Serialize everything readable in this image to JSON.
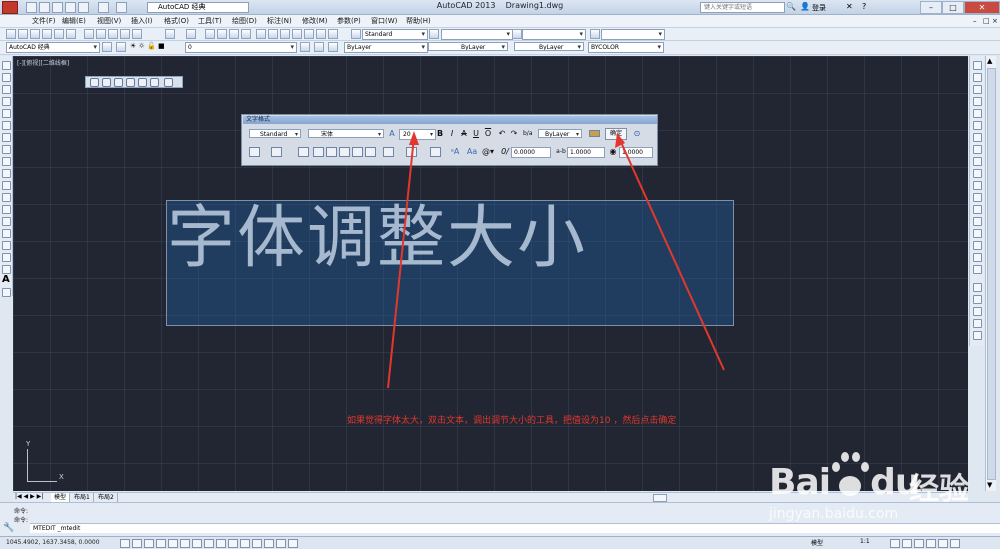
{
  "window": {
    "app_title": "AutoCAD 2013",
    "doc_title": "Drawing1.dwg",
    "workspace": "AutoCAD 经典",
    "search_placeholder": "键入关键字或短语",
    "login": "登录"
  },
  "menus": [
    "文件(F)",
    "编辑(E)",
    "视图(V)",
    "插入(I)",
    "格式(O)",
    "工具(T)",
    "绘图(D)",
    "标注(N)",
    "修改(M)",
    "参数(P)",
    "窗口(W)",
    "帮助(H)"
  ],
  "toolbar": {
    "text_style": "Standard",
    "workspace2": "AutoCAD 经典",
    "layer": "0",
    "color": "ByLayer",
    "linetype": "ByLayer",
    "lineweight": "ByLayer",
    "plotstyle": "BYCOLOR"
  },
  "viewport_label": "[-][俯视][二维线框]",
  "text_format": {
    "caption": "文字格式",
    "style": "Standard",
    "font": "宋体",
    "height": "20",
    "color": "ByLayer",
    "ok_label": "确定",
    "oblique": "0.0000",
    "tracking": "1.0000",
    "width": "1.0000"
  },
  "mtext_content": "字体调整大小",
  "annotation": "如果觉得字体太大，双击文本，调出调节大小的工具，把值设为10 ，然后点击确定",
  "ucs": {
    "x": "X",
    "y": "Y"
  },
  "tabs": [
    "模型",
    "布局1",
    "布局2"
  ],
  "command": {
    "line1": "命令:",
    "line2": "命令:",
    "input": "MTEDIT _mtedit"
  },
  "status": {
    "coordinates": "1045.4902,  1637.3458,  0.0000",
    "model": "模型",
    "scale": "1:1"
  },
  "watermark": {
    "brand": "Bai",
    "brand2": "du",
    "cn": "经验",
    "url": "jingyan.baidu.com"
  },
  "colors": {
    "canvas": "#222632",
    "annotation_red": "#e3372d",
    "selection_blue": "#1e5a96"
  }
}
